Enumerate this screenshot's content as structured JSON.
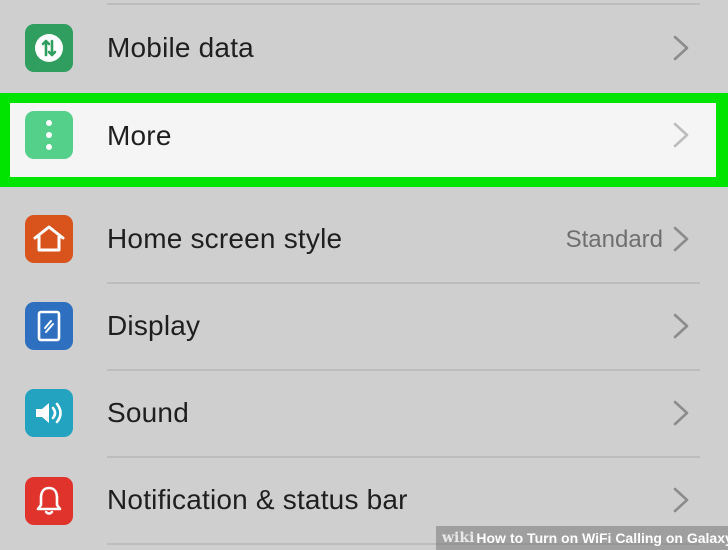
{
  "settings": {
    "items": [
      {
        "id": "mobile-data",
        "label": "Mobile data",
        "value": "",
        "icon": "mobile-data-icon",
        "icon_color": "#2f9e5e"
      },
      {
        "id": "more",
        "label": "More",
        "value": "",
        "icon": "more-dots-icon",
        "icon_color": "#55d08a"
      },
      {
        "id": "home-screen-style",
        "label": "Home screen style",
        "value": "Standard",
        "icon": "home-icon",
        "icon_color": "#d8541c"
      },
      {
        "id": "display",
        "label": "Display",
        "value": "",
        "icon": "display-icon",
        "icon_color": "#2e6fc0"
      },
      {
        "id": "sound",
        "label": "Sound",
        "value": "",
        "icon": "speaker-icon",
        "icon_color": "#23a3bf"
      },
      {
        "id": "notification",
        "label": "Notification & status bar",
        "value": "",
        "icon": "bell-icon",
        "icon_color": "#e0332b"
      }
    ]
  },
  "highlight_color": "#00e400",
  "watermark": {
    "wiki": "wiki",
    "how": "How",
    "rest": "to Turn on WiFi Calling on Galaxy"
  }
}
